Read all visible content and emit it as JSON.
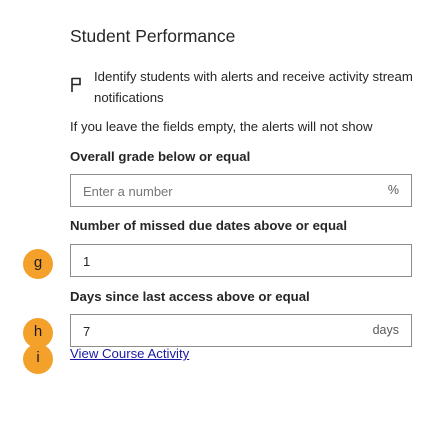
{
  "section": {
    "title": "Student Performance"
  },
  "alerts": {
    "description": "Identify students with alerts and receive activity stream notifications",
    "note": "If you leave the fields empty, the alerts will not show",
    "flag_icon": "flag-icon"
  },
  "fields": {
    "grade": {
      "label": "Overall grade below or equal",
      "placeholder": "Enter a number",
      "value": "",
      "suffix": "%"
    },
    "missed": {
      "label": "Number of missed due dates above or equal",
      "value": "1",
      "suffix": ""
    },
    "access": {
      "label": "Days since last access above or equal",
      "value": "7",
      "suffix": "days"
    }
  },
  "link": {
    "label": "View Course Activity"
  },
  "badges": {
    "g": "g",
    "h": "h",
    "i": "i",
    "color": "#f4a12b"
  },
  "colors": {
    "link": "#1a1aa6",
    "border": "#8c8c8c",
    "text": "#262626"
  }
}
